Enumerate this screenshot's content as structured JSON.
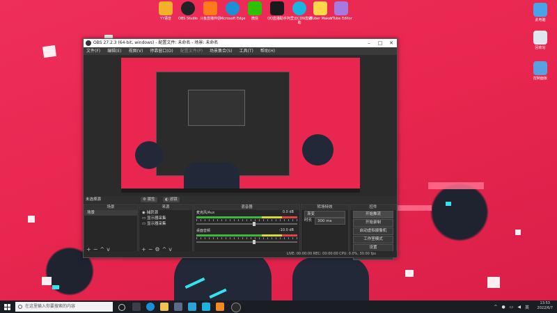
{
  "desktop": {
    "top_icons": [
      {
        "label": "YY语音",
        "color": "#f2b12a"
      },
      {
        "label": "OBS Studio",
        "color": "#222222"
      },
      {
        "label": "斗鱼直播伴侣",
        "color": "#ff7a1c"
      },
      {
        "label": "Microsoft Edge",
        "color": "#1d8fd6"
      },
      {
        "label": "微信",
        "color": "#2dc100"
      },
      {
        "label": "QQ直播助手",
        "color": "#1a1a1a"
      },
      {
        "label": "阿里云CDN直播助",
        "color": "#1bb3e0"
      },
      {
        "label": "VTuber Maker",
        "color": "#ffd84a"
      },
      {
        "label": "VTube Editor",
        "color": "#a77ae0"
      }
    ],
    "right_icons": [
      {
        "label": "此电脑",
        "color": "#4aa3e8"
      },
      {
        "label": "回收站",
        "color": "#e0e6ee"
      },
      {
        "label": "控制面板",
        "color": "#5aa0e0"
      }
    ]
  },
  "obs": {
    "title": "OBS 27.2.3 (64-bit, windows) - 配置文件: 未命名 - 场景: 未命名",
    "menu": [
      "文件(F)",
      "编辑(E)",
      "视图(V)",
      "停靠窗口(D)",
      "配置文件(P)",
      "场景集合(S)",
      "工具(T)",
      "帮助(H)"
    ],
    "scene_label": "未选择源",
    "properties_btn": "属性",
    "filters_btn": "滤镜",
    "scenes_header": "场景",
    "scenes": [
      "场景"
    ],
    "sources_header": "来源",
    "sources": [
      "捕获源",
      "显示器采集",
      "显示器采集"
    ],
    "mixer_header": "混音器",
    "mixer": [
      {
        "name": "麦克风/Aux",
        "db": "0.0 dB"
      },
      {
        "name": "桌面音频",
        "db": "-10.0 dB"
      }
    ],
    "transitions_header": "转场特效",
    "transition_type": "渐变",
    "duration_label": "时长",
    "duration_value": "300 ms",
    "controls_header": "控件",
    "controls": [
      "开始推流",
      "开始录制",
      "启动虚拟摄像机",
      "工作室模式",
      "设置",
      "退出"
    ],
    "status": "LIVE: 00:00:00    REC: 00:00:00    CPU: 0.0%, 30.00 fps"
  },
  "taskbar": {
    "search_placeholder": "在这里输入你要搜索的内容",
    "time": "13:53",
    "date": "2022/6/7",
    "lang": "英"
  }
}
